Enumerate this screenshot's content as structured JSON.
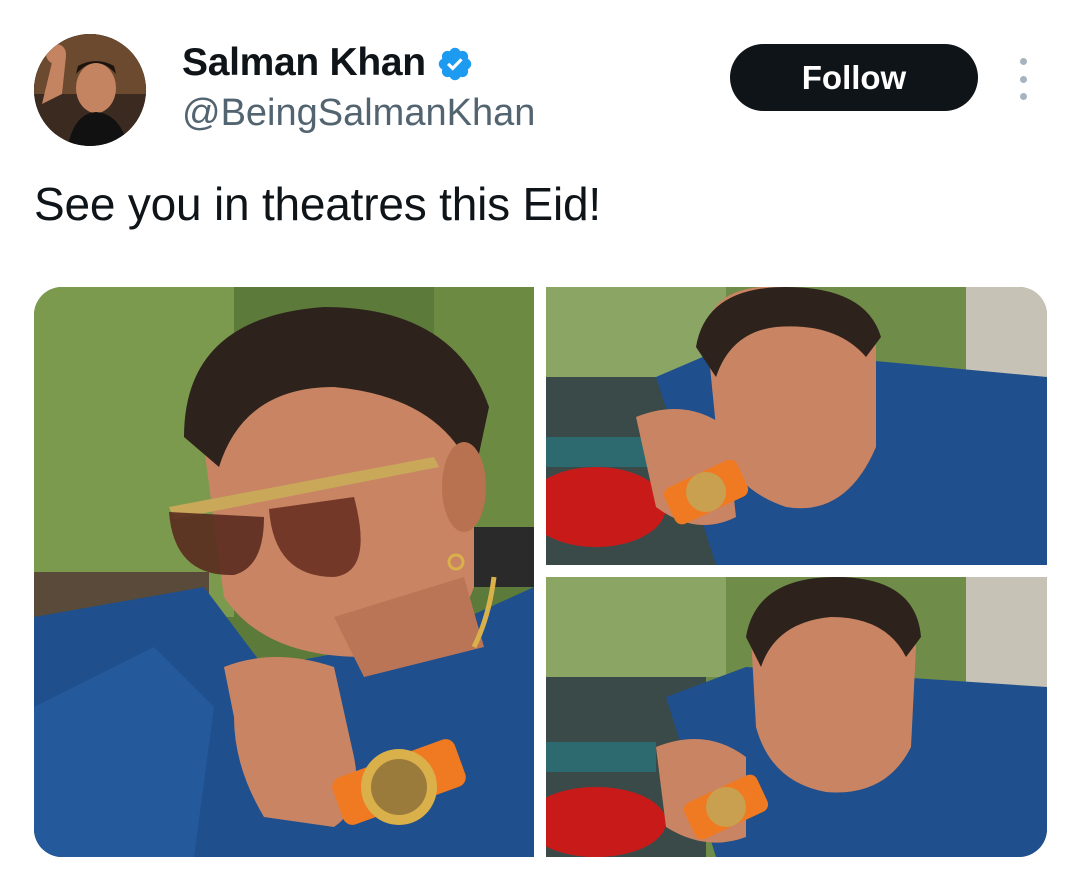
{
  "tweet": {
    "author": {
      "display_name": "Salman Khan",
      "handle": "@BeingSalmanKhan",
      "verified": true,
      "avatar_icon": "profile-photo"
    },
    "follow_label": "Follow",
    "more_icon": "more-vertical-icon",
    "text": "See you in theatres this Eid!",
    "media": [
      {
        "name": "photo-1"
      },
      {
        "name": "photo-2"
      },
      {
        "name": "photo-3"
      }
    ]
  },
  "colors": {
    "follow_bg": "#0f1419",
    "verified_blue": "#1d9bf0",
    "handle_gray": "#536471",
    "shirt_blue": "#1f4f8c",
    "watch_orange": "#f07a22"
  }
}
